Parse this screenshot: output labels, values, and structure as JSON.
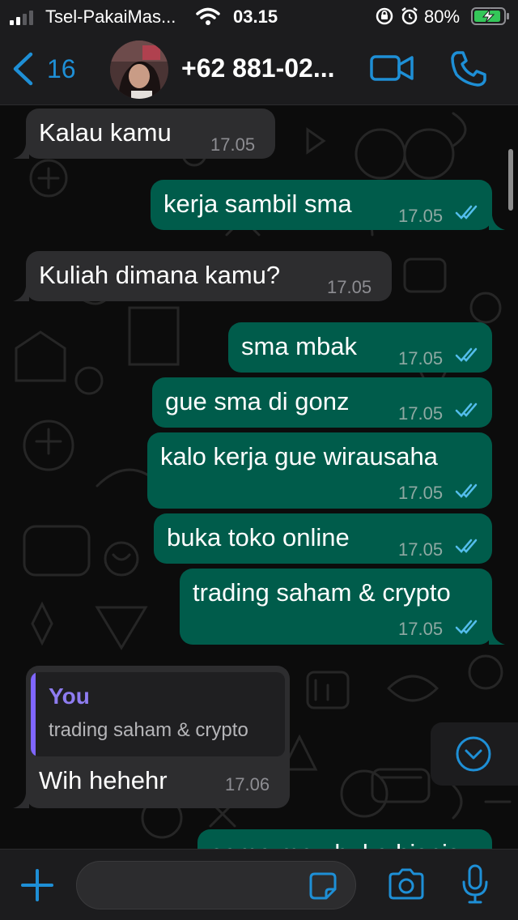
{
  "status_bar": {
    "carrier": "Tsel-PakaiMas...",
    "time": "03.15",
    "battery": "80%",
    "icons": [
      "signal-icon",
      "wifi-icon",
      "rotation-lock-icon",
      "alarm-icon",
      "battery-charging-icon"
    ]
  },
  "header": {
    "back_count": "16",
    "contact_name": "+62 881-02...",
    "icons": [
      "chevron-left-icon",
      "video-call-icon",
      "phone-call-icon"
    ]
  },
  "messages": [
    {
      "direction": "in",
      "text": "Kalau kamu",
      "time": "17.05"
    },
    {
      "direction": "out",
      "text": "kerja sambil sma",
      "time": "17.05",
      "read": true
    },
    {
      "direction": "in",
      "text": "Kuliah dimana kamu?",
      "time": "17.05"
    },
    {
      "direction": "out",
      "text": "sma mbak",
      "time": "17.05",
      "read": true
    },
    {
      "direction": "out",
      "text": "gue sma di gonz",
      "time": "17.05",
      "read": true
    },
    {
      "direction": "out",
      "text": "kalo kerja gue wirausaha",
      "time": "17.05",
      "read": true
    },
    {
      "direction": "out",
      "text": "buka toko online",
      "time": "17.05",
      "read": true
    },
    {
      "direction": "out",
      "text": "trading saham & crypto",
      "time": "17.05",
      "read": true
    },
    {
      "direction": "in",
      "text": "Wih hehehr",
      "time": "17.06",
      "quote": {
        "author": "You",
        "text": "trading saham & crypto"
      }
    },
    {
      "direction": "out",
      "text": "sama mau buka bisnis",
      "time": ""
    }
  ],
  "input_bar": {
    "placeholder": "",
    "icons": [
      "plus-icon",
      "sticker-icon",
      "camera-icon",
      "microphone-icon"
    ]
  },
  "colors": {
    "accent": "#1e8fd6",
    "outgoing_bubble": "#005c4b",
    "incoming_bubble": "#2d2d2f",
    "read_ticks": "#53bdeb",
    "quote_author": "#8e7cf0"
  }
}
